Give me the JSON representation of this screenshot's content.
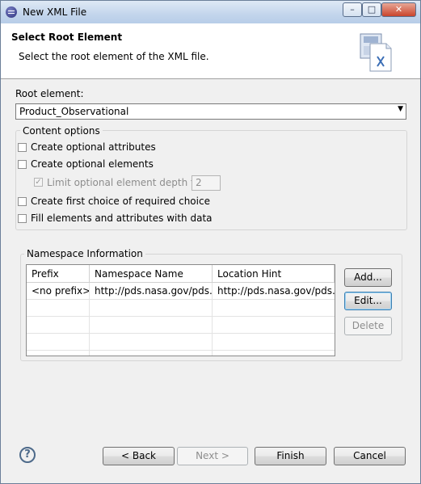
{
  "window": {
    "title": "New XML File",
    "minimize": "–",
    "maximize": "□",
    "close": "✕"
  },
  "header": {
    "title": "Select Root Element",
    "description": "Select the root element of the XML file.",
    "icon": "xml-file-wizard-icon"
  },
  "root_element": {
    "label": "Root element:",
    "value": "Product_Observational",
    "arrow": "▼"
  },
  "content_options": {
    "legend": "Content options",
    "options": [
      {
        "label": "Create optional attributes",
        "checked": false,
        "enabled": true
      },
      {
        "label": "Create optional elements",
        "checked": false,
        "enabled": true
      },
      {
        "label": "Limit optional element depth to:",
        "checked": true,
        "enabled": false
      },
      {
        "label": "Create first choice of required choice",
        "checked": false,
        "enabled": true
      },
      {
        "label": "Fill elements and attributes with data",
        "checked": false,
        "enabled": true
      }
    ],
    "depth_value": "2",
    "check_glyph": "✓"
  },
  "namespace": {
    "legend": "Namespace Information",
    "columns": [
      "Prefix",
      "Namespace Name",
      "Location Hint"
    ],
    "rows": [
      [
        "<no prefix>",
        "http://pds.nasa.gov/pds...",
        "http://pds.nasa.gov/pds..."
      ]
    ],
    "buttons": {
      "add": "Add...",
      "edit": "Edit...",
      "delete": "Delete"
    }
  },
  "footer": {
    "help": "?",
    "back": "< Back",
    "next": "Next >",
    "finish": "Finish",
    "cancel": "Cancel"
  }
}
